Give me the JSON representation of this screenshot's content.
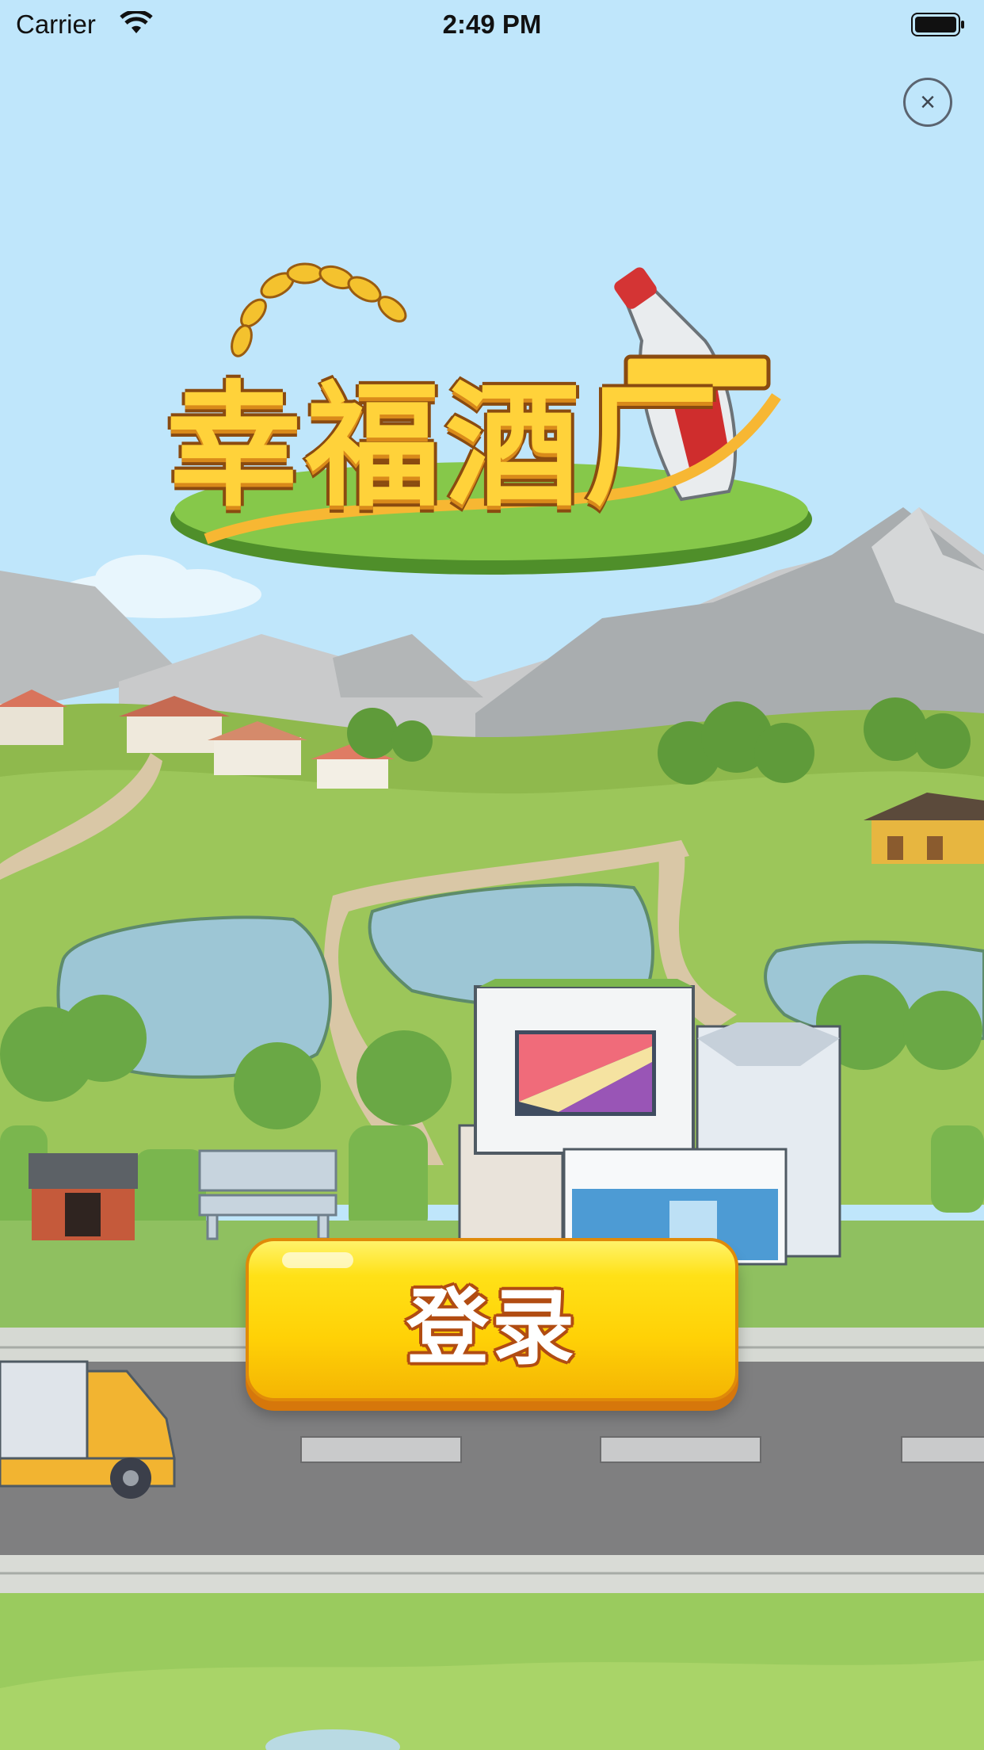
{
  "status_bar": {
    "carrier": "Carrier",
    "time": "2:49 PM"
  },
  "close_button": {
    "symbol": "×",
    "icon": "close-icon"
  },
  "logo": {
    "title": "幸福酒厂"
  },
  "login_button": {
    "label": "登录"
  },
  "colors": {
    "sky": "#bfe6fb",
    "button_yellow": "#ffd106",
    "button_border": "#e08a09",
    "text_outline": "#b14c12"
  }
}
